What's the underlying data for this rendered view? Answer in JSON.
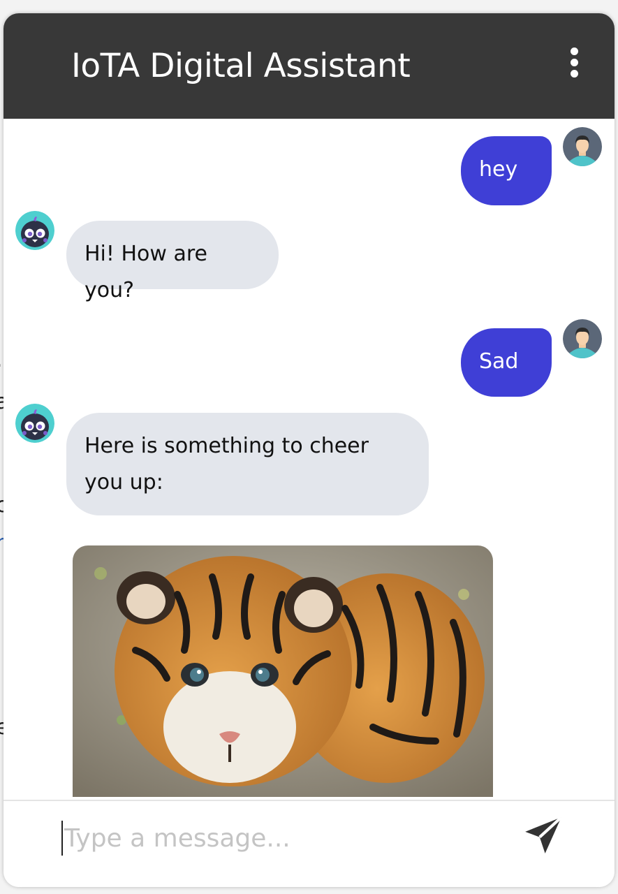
{
  "header": {
    "title": "IoTA Digital Assistant",
    "menu_icon": "kebab-menu-icon"
  },
  "messages": [
    {
      "sender": "user",
      "text": "hey"
    },
    {
      "sender": "bot",
      "text": "Hi! How are you?"
    },
    {
      "sender": "user",
      "text": "Sad"
    },
    {
      "sender": "bot",
      "text": "Here is something to cheer you up:"
    },
    {
      "sender": "bot",
      "type": "image",
      "icon": "tiger-cub-image"
    }
  ],
  "composer": {
    "placeholder": "Type a message...",
    "value": "",
    "send_icon": "send-icon"
  },
  "colors": {
    "header_bg": "#383838",
    "user_bubble": "#3f3fd6",
    "bot_bubble": "#e3e6ec"
  }
}
